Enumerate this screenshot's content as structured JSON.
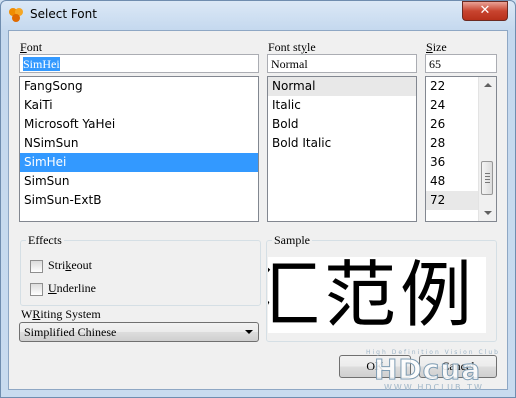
{
  "window": {
    "title": "Select Font",
    "close_label": "✕"
  },
  "font": {
    "label_accel": "F",
    "label_rest": "ont",
    "value": "SimHei",
    "items": [
      "FangSong",
      "KaiTi",
      "Microsoft YaHei",
      "NSimSun",
      "SimHei",
      "SimSun",
      "SimSun-ExtB"
    ]
  },
  "font_style": {
    "label_pre": "Font st",
    "label_accel": "y",
    "label_post": "le",
    "value": "Normal",
    "items": [
      "Normal",
      "Italic",
      "Bold",
      "Bold Italic"
    ]
  },
  "size": {
    "label_accel": "S",
    "label_rest": "ize",
    "value": "65",
    "items": [
      "22",
      "24",
      "26",
      "28",
      "36",
      "48",
      "72"
    ]
  },
  "effects": {
    "title": "Effects",
    "strikeout_accel": "k",
    "strikeout_pre": "Stri",
    "strikeout_post": "eout",
    "underline_accel": "U",
    "underline_rest": "nderline"
  },
  "writing_system": {
    "label_accel": "R",
    "label_pre": "W",
    "label_post": "iting System",
    "value": "Simplified Chinese"
  },
  "sample": {
    "title": "Sample",
    "text": "汇范例"
  },
  "buttons": {
    "ok": "OK",
    "cancel": "Cancel"
  },
  "watermark": {
    "tagline": "High Definition Vision Club",
    "logo": "HDcua",
    "url": "WWW.HDCLUB.TW"
  },
  "colors": {
    "selection": "#3399ff",
    "close": "#c8442f"
  }
}
